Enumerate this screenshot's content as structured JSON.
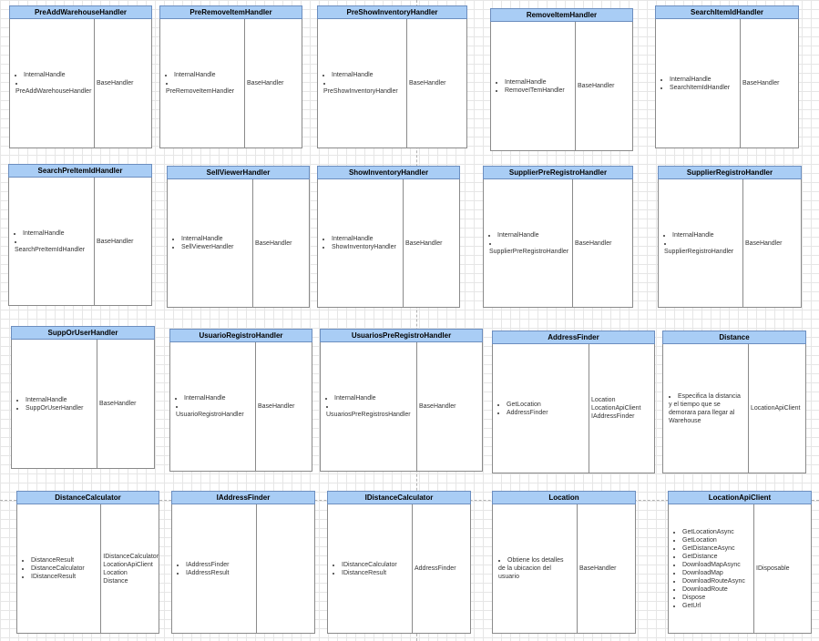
{
  "classes": [
    {
      "name": "PreAddWarehouseHandler",
      "items": [
        "InternalHandle",
        "PreAddWarehouseHandler"
      ],
      "parents": [
        "BaseHandler"
      ]
    },
    {
      "name": "PreRemoveItemHandler",
      "items": [
        "InternalHandle",
        "PreRemoveItemHandler"
      ],
      "parents": [
        "BaseHandler"
      ]
    },
    {
      "name": "PreShowInventoryHandler",
      "items": [
        "InternalHandle",
        "PreShowInventoryHandler"
      ],
      "parents": [
        "BaseHandler"
      ]
    },
    {
      "name": "RemoveItemHandler",
      "items": [
        "InternalHandle",
        "RemoveITemHandler"
      ],
      "parents": [
        "BaseHandler"
      ]
    },
    {
      "name": "SearchItemIdHandler",
      "items": [
        "InternalHandle",
        "SearchItemIdHandler"
      ],
      "parents": [
        "BaseHandler"
      ]
    },
    {
      "name": "SearchPreItemIdHandler",
      "items": [
        "InternalHandle",
        "SearchPreItemIdHandler"
      ],
      "parents": [
        "BaseHandler"
      ]
    },
    {
      "name": "SellViewerHandler",
      "items": [
        "InternalHandle",
        "SellViewerHandler"
      ],
      "parents": [
        "BaseHandler"
      ]
    },
    {
      "name": "ShowInventoryHandler",
      "items": [
        "InternalHandle",
        "ShowInventoryHandler"
      ],
      "parents": [
        "BaseHandler"
      ]
    },
    {
      "name": "SupplierPreRegistroHandler",
      "items": [
        "InternalHandle",
        "SupplierPreRegistroHandler"
      ],
      "parents": [
        "BaseHandler"
      ]
    },
    {
      "name": "SupplierRegistroHandler",
      "items": [
        "InternalHandle",
        "SupplierRegistroHandler"
      ],
      "parents": [
        "BaseHandler"
      ]
    },
    {
      "name": "SuppOrUserHandler",
      "items": [
        "InternalHandle",
        "SuppOrUserHandler"
      ],
      "parents": [
        "BaseHandler"
      ]
    },
    {
      "name": "UsuarioRegistroHandler",
      "items": [
        "InternalHandle",
        "UsuarioRegistroHandler"
      ],
      "parents": [
        "BaseHandler"
      ]
    },
    {
      "name": "UsuariosPreRegistroHandler",
      "items": [
        "InternalHandle",
        "UsuariosPreRegistrosHandler"
      ],
      "parents": [
        "BaseHandler"
      ]
    },
    {
      "name": "AddressFinder",
      "items": [
        "GetLocation",
        "AddressFinder"
      ],
      "parents": [
        "Location",
        "LocationApiClient",
        "IAddressFinder"
      ]
    },
    {
      "name": "Distance",
      "items": [
        "Especifica la distancia y el tiempo que se demorara para llegar al Warehouse"
      ],
      "parents": [
        "LocationApiClient"
      ]
    },
    {
      "name": "DistanceCalculator",
      "items": [
        "DistanceResult",
        "DistanceCalculator",
        "IDistanceResult"
      ],
      "parents": [
        "IDistanceCalculator",
        "LocationApiClient",
        "Location",
        "Distance"
      ]
    },
    {
      "name": "IAddressFinder",
      "items": [
        "IAddressFinder",
        "IAddressResult"
      ],
      "parents": []
    },
    {
      "name": "IDistanceCalculator",
      "items": [
        "IDistanceCalculator",
        "IDistanceResult"
      ],
      "parents": [
        "AddressFinder"
      ]
    },
    {
      "name": "Location",
      "items": [
        "Obtiene los detalles de la ubicacion del usuario"
      ],
      "parents": [
        "BaseHandler"
      ]
    },
    {
      "name": "LocationApiClient",
      "items": [
        "GetLocationAsync",
        "GetLocation",
        "GetDistanceAsync",
        "GetDistance",
        "DownloadMapAsync",
        "DownloadMap",
        "DownloadRouteAsync",
        "DownloadRoute",
        "Dispose",
        "GetUrl"
      ],
      "parents": [
        "IDisposable"
      ]
    }
  ]
}
